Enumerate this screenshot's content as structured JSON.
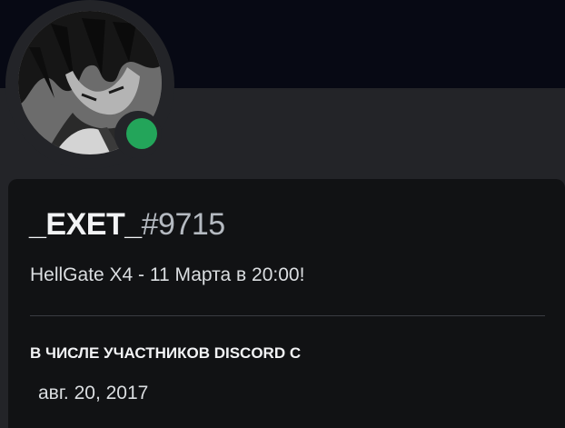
{
  "profile": {
    "username": "_EXET_",
    "discriminator": "#9715",
    "custom_status": "HellGate X4 - 11 Марта в 20:00!",
    "presence_status": "online",
    "status_color": "#23a55a"
  },
  "member_since": {
    "heading": "В ЧИСЛЕ УЧАСТНИКОВ DISCORD С",
    "date": "авг. 20, 2017"
  },
  "colors": {
    "banner": "#070914",
    "card_background": "#111214",
    "panel_background": "#232428"
  }
}
